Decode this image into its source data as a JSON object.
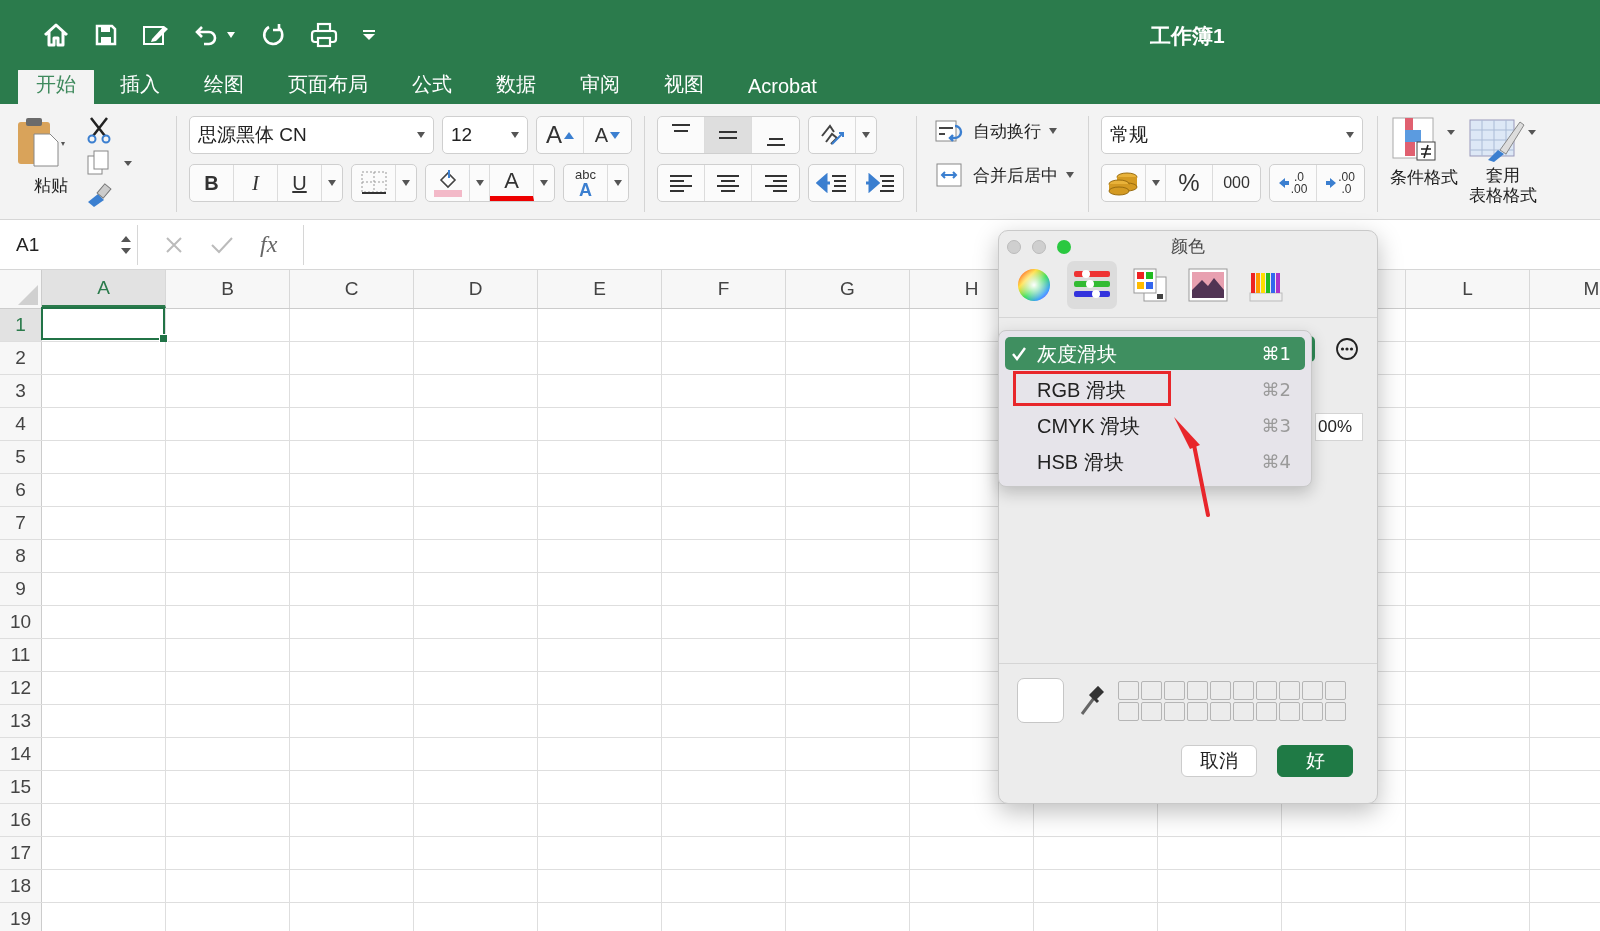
{
  "title_bar": {
    "title": "工作簿1"
  },
  "tabs": [
    {
      "label": "开始",
      "selected": true
    },
    {
      "label": "插入",
      "selected": false
    },
    {
      "label": "绘图",
      "selected": false
    },
    {
      "label": "页面布局",
      "selected": false
    },
    {
      "label": "公式",
      "selected": false
    },
    {
      "label": "数据",
      "selected": false
    },
    {
      "label": "审阅",
      "selected": false
    },
    {
      "label": "视图",
      "selected": false
    },
    {
      "label": "Acrobat",
      "selected": false
    }
  ],
  "ribbon": {
    "paste": {
      "label": "粘贴"
    },
    "font": {
      "name": "思源黑体 CN",
      "size": "12",
      "grow": "A",
      "shrink": "A",
      "bold": "B",
      "italic": "I",
      "underline": "U",
      "font_color": "A",
      "phonetic_top": "abc",
      "phonetic_bottom": "A"
    },
    "vertical_align": [
      {
        "selected": false
      },
      {
        "selected": true
      },
      {
        "selected": false
      }
    ],
    "wrap": {
      "label": "自动换行"
    },
    "merge": {
      "label": "合并后居中"
    },
    "number": {
      "format": "常规",
      "percent": "%",
      "thousands": "000",
      "increase_decimal": [
        ".0",
        ".00"
      ],
      "decrease_decimal": [
        ".00",
        ".0"
      ]
    },
    "styles": {
      "conditional": "条件格式",
      "table_lines": [
        "套用",
        "表格格式"
      ]
    }
  },
  "formula_bar": {
    "name_box": "A1",
    "function": "fx"
  },
  "sheet": {
    "columns": {
      "left": [
        {
          "label": "A",
          "selected": true
        },
        {
          "label": "B",
          "selected": false
        },
        {
          "label": "C",
          "selected": false
        },
        {
          "label": "D",
          "selected": false
        },
        {
          "label": "E",
          "selected": false
        },
        {
          "label": "F",
          "selected": false
        },
        {
          "label": "G",
          "selected": false
        },
        {
          "label": "H",
          "selected": false
        }
      ],
      "right": [
        {
          "label": "L",
          "selected": false
        },
        {
          "label": "M",
          "selected": false
        }
      ]
    },
    "rows": [
      {
        "label": "1",
        "selected": true
      },
      {
        "label": "2",
        "selected": false
      },
      {
        "label": "3",
        "selected": false
      },
      {
        "label": "4",
        "selected": false
      },
      {
        "label": "5",
        "selected": false
      },
      {
        "label": "6",
        "selected": false
      },
      {
        "label": "7",
        "selected": false
      },
      {
        "label": "8",
        "selected": false
      },
      {
        "label": "9",
        "selected": false
      },
      {
        "label": "10",
        "selected": false
      },
      {
        "label": "11",
        "selected": false
      },
      {
        "label": "12",
        "selected": false
      },
      {
        "label": "13",
        "selected": false
      },
      {
        "label": "14",
        "selected": false
      },
      {
        "label": "15",
        "selected": false
      },
      {
        "label": "16",
        "selected": false
      },
      {
        "label": "17",
        "selected": false
      },
      {
        "label": "18",
        "selected": false
      },
      {
        "label": "19",
        "selected": false
      }
    ]
  },
  "color_dialog": {
    "title": "颜色",
    "modes": [
      {
        "kind": "wheel",
        "selected": false
      },
      {
        "kind": "sliders",
        "selected": true
      },
      {
        "kind": "palettes",
        "selected": false
      },
      {
        "kind": "image",
        "selected": false
      },
      {
        "kind": "pencils",
        "selected": false
      }
    ],
    "menu": [
      {
        "label": "灰度滑块",
        "shortcut": "⌘1",
        "checked": true,
        "selected": true
      },
      {
        "label": "RGB 滑块",
        "shortcut": "⌘2",
        "checked": false,
        "selected": false
      },
      {
        "label": "CMYK 滑块",
        "shortcut": "⌘3",
        "checked": false,
        "selected": false
      },
      {
        "label": "HSB 滑块",
        "shortcut": "⌘4",
        "checked": false,
        "selected": false
      }
    ],
    "field_value": "00%",
    "buttons": [
      {
        "label": "取消",
        "kind": "cancel"
      },
      {
        "label": "好",
        "kind": "default"
      }
    ]
  }
}
